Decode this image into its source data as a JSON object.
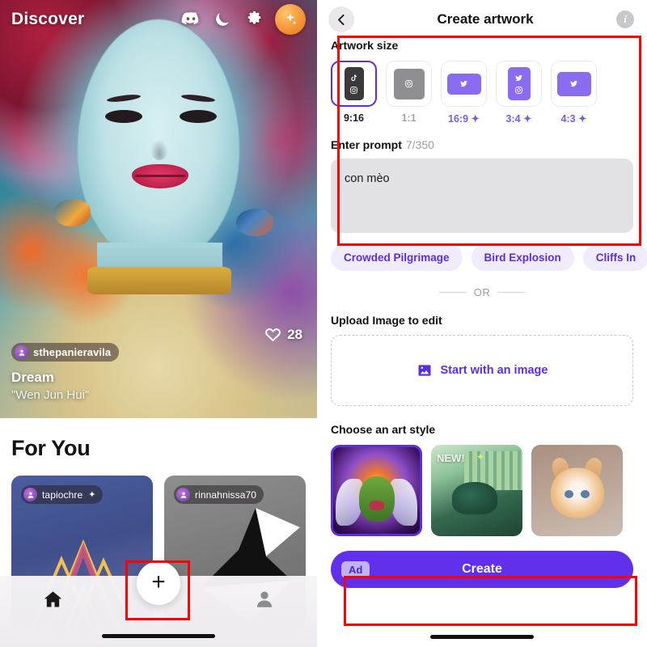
{
  "left": {
    "header": {
      "title": "Discover",
      "icons": [
        "discord-icon",
        "moon-icon",
        "gear-icon",
        "sparkle-icon"
      ]
    },
    "featured": {
      "username": "sthepanieravila",
      "title": "Dream",
      "subtitle": "\"Wen Jun Hui\"",
      "likes": "28",
      "like_icon": "heart-icon"
    },
    "for_you": {
      "heading": "For You",
      "cards": [
        {
          "username": "tapiochre",
          "badge": "✦"
        },
        {
          "username": "rinnahnissa70",
          "badge": ""
        }
      ]
    },
    "tabbar": {
      "items": [
        "home-icon",
        "plus-button",
        "profile-icon"
      ]
    }
  },
  "right": {
    "header": {
      "back_icon": "chevron-left-icon",
      "title": "Create artwork",
      "info_icon": "info-icon"
    },
    "artwork_size": {
      "label": "Artwork size",
      "options": [
        {
          "ratio": "9:16",
          "selected": true,
          "premium": false,
          "platforms": [
            "tiktok",
            "instagram"
          ]
        },
        {
          "ratio": "1:1",
          "selected": false,
          "premium": false,
          "platforms": [
            "instagram"
          ]
        },
        {
          "ratio": "16:9",
          "selected": false,
          "premium": true,
          "platforms": [
            "twitter"
          ]
        },
        {
          "ratio": "3:4",
          "selected": false,
          "premium": true,
          "platforms": [
            "twitter",
            "instagram"
          ]
        },
        {
          "ratio": "4:3",
          "selected": false,
          "premium": true,
          "platforms": [
            "twitter"
          ]
        }
      ],
      "premium_mark": "✦"
    },
    "prompt": {
      "label": "Enter prompt",
      "counter": "7/350",
      "value": "con mèo",
      "placeholder": "Enter prompt"
    },
    "suggestions": [
      "Crowded Pilgrimage",
      "Bird Explosion",
      "Cliffs In"
    ],
    "divider": {
      "text": "OR"
    },
    "upload": {
      "label": "Upload Image to edit",
      "button_label": "Start with an image",
      "button_icon": "image-icon"
    },
    "art_style": {
      "label": "Choose an art style",
      "items": [
        {
          "name": "fairy-style",
          "selected": true,
          "badge": ""
        },
        {
          "name": "pixel-cat-style",
          "selected": false,
          "badge": "NEW!"
        },
        {
          "name": "kitten-style",
          "selected": false,
          "badge": ""
        }
      ]
    },
    "create": {
      "ad_label": "Ad",
      "label": "Create"
    }
  },
  "colors": {
    "accent_purple": "#6030ec",
    "accent_light": "#8b6cf0",
    "chip_bg": "#f1ecfb",
    "highlight_red": "#ff0000",
    "ad_badge_bg": "#c3b1f7"
  }
}
